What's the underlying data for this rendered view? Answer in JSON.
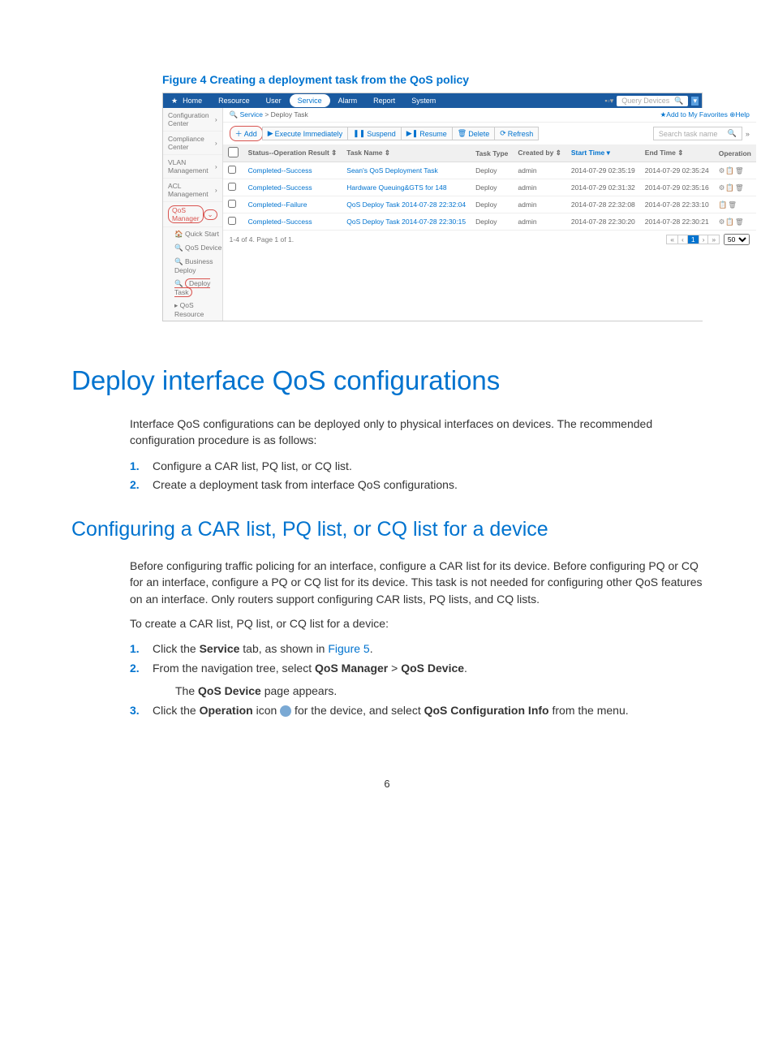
{
  "figure_caption": "Figure 4 Creating a deployment task from the QoS policy",
  "screenshot": {
    "topnav": {
      "home": "Home",
      "tabs": [
        "Resource",
        "User",
        "Service",
        "Alarm",
        "Report",
        "System"
      ],
      "active": "Service",
      "query": "Query Devices"
    },
    "breadcrumb": {
      "s1": "Service",
      "s2": "Deploy Task"
    },
    "fav": "Add to My Favorites",
    "help": "Help",
    "sidebar": {
      "conf": "Configuration Center",
      "comp": "Compliance Center",
      "vlan": "VLAN Management",
      "acl": "ACL Management",
      "qos": "QoS Manager",
      "quick": "Quick Start",
      "device": "QoS Device",
      "biz": "Business Deploy",
      "deploy": "Deploy Task",
      "resource": "QoS Resource"
    },
    "toolbar": {
      "add": "Add",
      "exec": "Execute Immediately",
      "suspend": "Suspend",
      "resume": "Resume",
      "delete": "Delete",
      "refresh": "Refresh",
      "search_ph": "Search task name"
    },
    "headers": {
      "chk": "",
      "status": "Status--Operation Result ⇕",
      "task": "Task Name ⇕",
      "type": "Task Type",
      "by": "Created by ⇕",
      "start": "Start Time ▾",
      "end": "End Time ⇕",
      "op": "Operation"
    },
    "rows": [
      {
        "status": "Completed--Success",
        "task": "Sean's QoS Deployment Task",
        "type": "Deploy",
        "by": "admin",
        "start": "2014-07-29 02:35:19",
        "end": "2014-07-29 02:35:24"
      },
      {
        "status": "Completed--Success",
        "task": "Hardware Queuing&GTS for 148",
        "type": "Deploy",
        "by": "admin",
        "start": "2014-07-29 02:31:32",
        "end": "2014-07-29 02:35:16"
      },
      {
        "status": "Completed--Failure",
        "task": "QoS Deploy Task 2014-07-28 22:32:04",
        "type": "Deploy",
        "by": "admin",
        "start": "2014-07-28 22:32:08",
        "end": "2014-07-28 22:33:10"
      },
      {
        "status": "Completed--Success",
        "task": "QoS Deploy Task 2014-07-28 22:30:15",
        "type": "Deploy",
        "by": "admin",
        "start": "2014-07-28 22:30:20",
        "end": "2014-07-28 22:30:21"
      }
    ],
    "pager_text": "1-4 of 4. Page 1 of 1.",
    "page_size": "50"
  },
  "h1": "Deploy interface QoS configurations",
  "intro": "Interface QoS configurations can be deployed only to physical interfaces on devices. The recommended configuration procedure is as follows:",
  "steps1": {
    "1": "Configure a CAR list, PQ list, or CQ list.",
    "2": "Create a deployment task from interface QoS configurations."
  },
  "h2": "Configuring a CAR list, PQ list, or CQ list for a device",
  "para2": "Before configuring traffic policing for an interface, configure a CAR list for its device. Before configuring PQ or CQ for an interface, configure a PQ or CQ list for its device. This task is not needed for configuring other QoS features on an interface. Only routers support configuring CAR lists, PQ lists, and CQ lists.",
  "para3": "To create a CAR list, PQ list, or CQ list for a device:",
  "steps2": {
    "1a": "Click the ",
    "1b": "Service",
    "1c": " tab, as shown in ",
    "1d": "Figure 5",
    "1e": ".",
    "2a": "From the navigation tree, select ",
    "2b": "QoS Manager",
    "2c": " > ",
    "2d": "QoS Device",
    "2e": ".",
    "2f": "The ",
    "2g": "QoS Device",
    "2h": " page appears.",
    "3a": "Click the ",
    "3b": "Operation",
    "3c": " icon ",
    "3d": " for the device, and select ",
    "3e": "QoS Configuration Info",
    "3f": " from the menu."
  },
  "page_number": "6"
}
